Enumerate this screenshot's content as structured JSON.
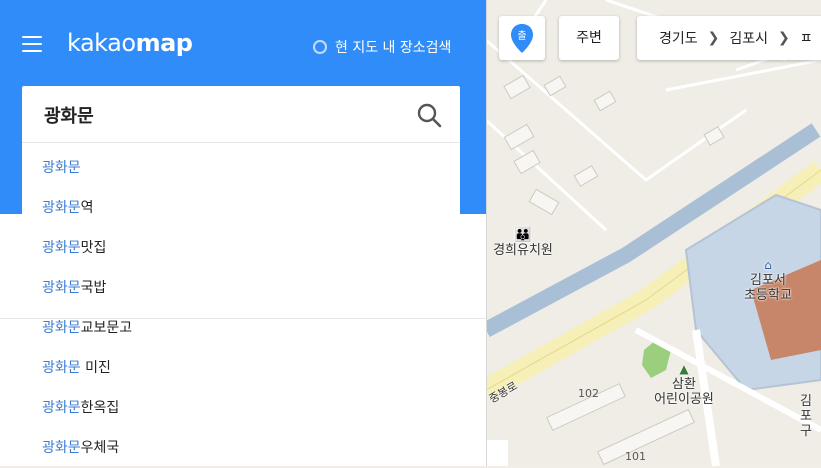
{
  "header": {
    "logo_light": "kakao",
    "logo_bold": "map",
    "nearby_search_label": "현 지도 내 장소검색"
  },
  "search": {
    "value": "광화문",
    "placeholder": ""
  },
  "suggestions": [
    {
      "highlight": "광화문",
      "rest": ""
    },
    {
      "highlight": "광화문",
      "rest": "역"
    },
    {
      "highlight": "광화문",
      "rest": "맛집"
    },
    {
      "highlight": "광화문",
      "rest": "국밥"
    },
    {
      "highlight": "광화문",
      "rest": "교보문고"
    },
    {
      "highlight": "광화문",
      "rest": " 미진"
    },
    {
      "highlight": "광화문",
      "rest": "한옥집"
    },
    {
      "highlight": "광화문",
      "rest": "우체국"
    }
  ],
  "map_controls": {
    "location_button_label": "출",
    "nearby_button_label": "주변",
    "breadcrumb": [
      "경기도",
      "김포시",
      "ㅍ"
    ]
  },
  "map_labels": {
    "kindergarten": "경희유치원",
    "school_line1": "김포서",
    "school_line2": "초등학교",
    "park_line1": "삼환",
    "park_line2": "어린이공원",
    "road": "중봉로",
    "building_102": "102",
    "building_101": "101",
    "edge_line1": "김포",
    "edge_line2": "구"
  },
  "colors": {
    "brand_blue": "#2f8cf8",
    "highlight": "#3a7bd5",
    "road_yellow": "#f6efb8",
    "water": "#a9bfd6"
  }
}
